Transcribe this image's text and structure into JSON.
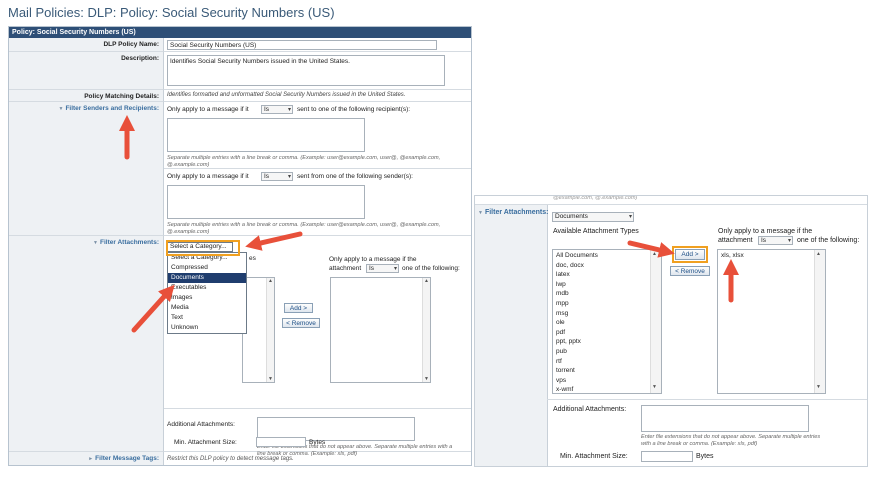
{
  "page_title": "Mail Policies: DLP: Policy: Social Security Numbers (US)",
  "panel_header": "Policy: Social Security Numbers (US)",
  "fields": {
    "policy_name_label": "DLP Policy Name:",
    "policy_name_value": "Social Security Numbers (US)",
    "description_label": "Description:",
    "description_value": "Identifies Social Security Numbers issued in the United States.",
    "matching_label": "Policy Matching Details:",
    "matching_value": "Identifies formatted and unformatted Social Security Numbers issued in the United States."
  },
  "senders": {
    "label": "Filter Senders and Recipients:",
    "recipient_prefix": "Only apply to a message if it",
    "recipient_op": "Is",
    "recipient_suffix": "sent to one of the following recipient(s):",
    "recipient_hint": "Separate multiple entries with a line break or comma. (Example: user@example.com, user@, @example.com, @.example.com)",
    "sender_prefix": "Only apply to a message if it",
    "sender_op": "Is",
    "sender_suffix": "sent from one of the following sender(s):",
    "sender_hint": "Separate multiple entries with a line break or comma. (Example: user@example.com, user@, @example.com, @.example.com)"
  },
  "attachments": {
    "label": "Filter Attachments:",
    "category_select": "Select a Category...",
    "category_options": [
      "Select a Category...",
      "Compressed",
      "Documents",
      "Executables",
      "Images",
      "Media",
      "Text",
      "Unknown"
    ],
    "selected_option": "Documents",
    "available_types_partial": "es",
    "only_apply_line1": "Only apply to a message if the",
    "attachment_word": "attachment",
    "attachment_op": "Is",
    "one_of": "one of the following:",
    "add_button": "Add >",
    "remove_button": "< Remove",
    "additional_label": "Additional Attachments:",
    "additional_hint": "Enter file extensions that do not appear above. Separate multiple entries with a line break or comma. (Example: xls, pdf)",
    "min_size_label": "Min. Attachment Size:",
    "min_size_unit": "Bytes"
  },
  "message_tags": {
    "label": "Filter Message Tags:",
    "hint": "Restrict this DLP policy to detect message tags."
  },
  "zoom_panel": {
    "cut_off_text": "@example.com, @.example.com)",
    "label": "Filter Attachments:",
    "category_value": "Documents",
    "available_label": "Available Attachment Types",
    "available_items": [
      "All Documents",
      "doc, docx",
      "latex",
      "lwp",
      "mdb",
      "mpp",
      "msg",
      "ole",
      "pdf",
      "ppt, pptx",
      "pub",
      "rtf",
      "torrent",
      "vps",
      "x-wmf"
    ],
    "only_apply_line1": "Only apply to a message if the",
    "attachment_word": "attachment",
    "attachment_op": "Is",
    "one_of": "one of the following:",
    "selected_items": [
      "xls, xlsx"
    ],
    "add_button": "Add >",
    "remove_button": "< Remove",
    "additional_label": "Additional Attachments:",
    "additional_hint": "Enter file extensions that do not appear above. Separate multiple entries with a line break or comma. (Example: xls, pdf)",
    "min_size_label": "Min. Attachment Size:",
    "min_size_unit": "Bytes"
  },
  "colors": {
    "header_bg": "#2e4f77",
    "link": "#3a6e9f",
    "highlight_box": "#f0a020",
    "arrow": "#e8503a",
    "selected_option_bg": "#1f3d6e"
  }
}
